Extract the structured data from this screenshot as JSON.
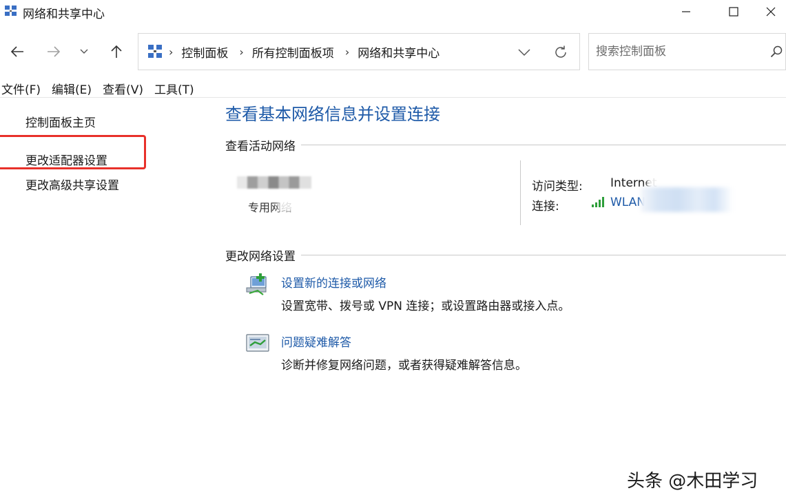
{
  "window": {
    "title": "网络和共享中心",
    "icon": "network-center-icon",
    "controls": [
      "minimize-icon",
      "maximize-icon",
      "close-icon"
    ]
  },
  "nav": {
    "back_icon": "arrow-left-icon",
    "forward_icon": "arrow-right-icon",
    "recent_icon": "chevron-down-icon",
    "up_icon": "arrow-up-icon"
  },
  "address": {
    "breadcrumbs": [
      "控制面板",
      "所有控制面板项",
      "网络和共享中心"
    ],
    "separator": "›"
  },
  "search": {
    "placeholder": "搜索控制面板",
    "value": ""
  },
  "menu": {
    "items": [
      "文件(F)",
      "编辑(E)",
      "查看(V)",
      "工具(T)"
    ]
  },
  "sidebar": {
    "home": "控制面板主页",
    "adapter": "更改适配器设置",
    "advanced": "更改高级共享设置"
  },
  "main": {
    "title": "查看基本网络信息并设置连接",
    "active_section": "查看活动网络",
    "network_type": "专用网络",
    "access_label": "访问类型:",
    "access_value": "Internet",
    "connection_label": "连接:",
    "connection_value": "WLAN",
    "change_section": "更改网络设置",
    "tasks": [
      {
        "link": "设置新的连接或网络",
        "desc": "设置宽带、拨号或 VPN 连接；或设置路由器或接入点。"
      },
      {
        "link": "问题疑难解答",
        "desc": "诊断并修复网络问题，或者获得疑难解答信息。"
      }
    ]
  },
  "colors": {
    "link": "#1e5aa8",
    "highlight_box": "#e8302a",
    "signal": "#2e9e3a"
  },
  "watermark": "头条 @木田学习"
}
